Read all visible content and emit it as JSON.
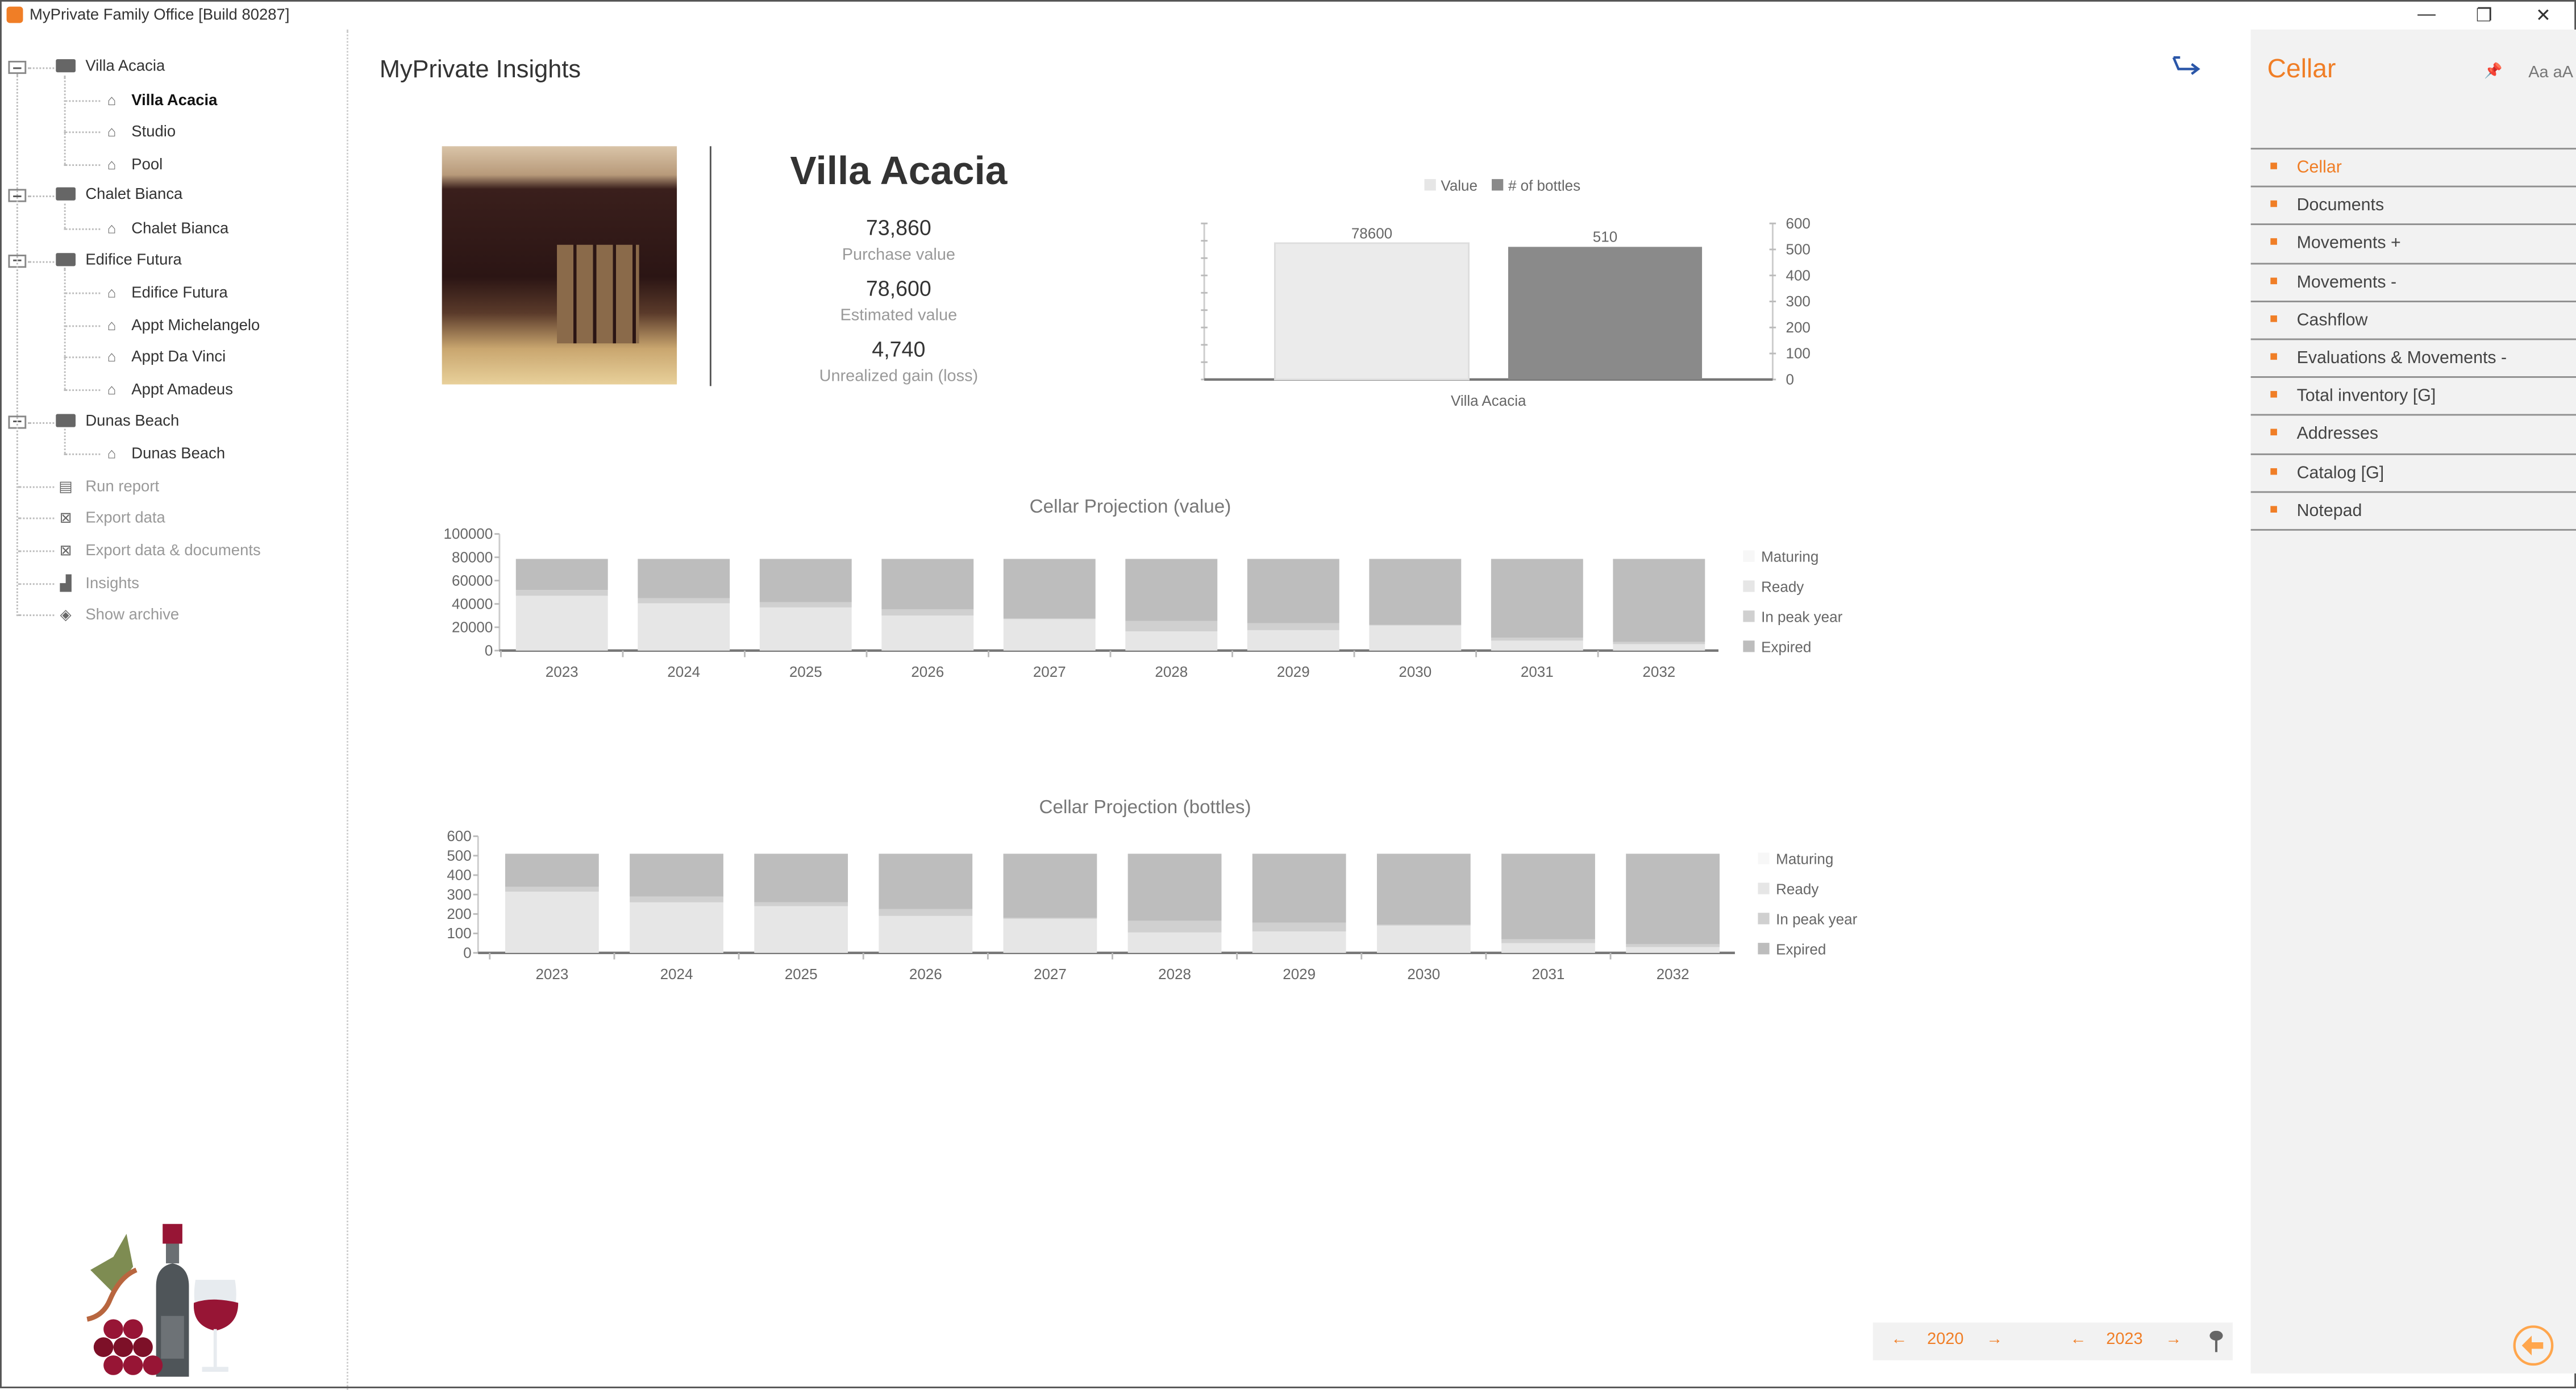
{
  "window": {
    "title": "MyPrivate Family Office [Build 80287]",
    "minimize": "—",
    "restore": "❐",
    "close": "✕"
  },
  "tree": {
    "groups": [
      {
        "label": "Villa Acacia",
        "children": [
          "Villa Acacia",
          "Studio",
          "Pool"
        ]
      },
      {
        "label": "Chalet Bianca",
        "children": [
          "Chalet Bianca"
        ]
      },
      {
        "label": "Edifice Futura",
        "children": [
          "Edifice Futura",
          "Appt Michelangelo",
          "Appt Da Vinci",
          "Appt Amadeus"
        ]
      },
      {
        "label": "Dunas Beach",
        "children": [
          "Dunas Beach"
        ]
      }
    ],
    "selected": "Villa Acacia",
    "actions": [
      {
        "label": "Run report",
        "icon": "report-icon"
      },
      {
        "label": "Export data",
        "icon": "excel-icon"
      },
      {
        "label": "Export data & documents",
        "icon": "excel-icon"
      },
      {
        "label": "Insights",
        "icon": "bar-chart-icon"
      },
      {
        "label": "Show archive",
        "icon": "archive-icon"
      }
    ]
  },
  "main": {
    "title": "MyPrivate Insights",
    "property": {
      "name": "Villa Acacia",
      "stats": [
        {
          "value": "73,860",
          "label": "Purchase value"
        },
        {
          "value": "78,600",
          "label": "Estimated value"
        },
        {
          "value": "4,740",
          "label": "Unrealized gain (loss)"
        }
      ]
    }
  },
  "colors": {
    "accent": "#f07e26",
    "maturing": "#f7f7f7",
    "ready": "#e6e6e6",
    "peak": "#d0d0d0",
    "expired": "#bdbdbd",
    "value_bar": "#ebebeb",
    "bottles_bar": "#8a8a8a"
  },
  "chart_data": [
    {
      "type": "bar",
      "title": "",
      "categories": [
        "Villa Acacia"
      ],
      "series": [
        {
          "name": "Value",
          "values": [
            78600
          ],
          "axis": "left",
          "label": "78600"
        },
        {
          "name": "# of bottles",
          "values": [
            510
          ],
          "axis": "right",
          "label": "510"
        }
      ],
      "ylim_left": [
        0,
        90000
      ],
      "ylim_right": [
        0,
        600
      ],
      "right_ticks": [
        "0",
        "100",
        "200",
        "300",
        "400",
        "500",
        "600"
      ],
      "legend": "top"
    },
    {
      "type": "bar",
      "stacked": true,
      "title": "Cellar Projection (value)",
      "categories": [
        "2023",
        "2024",
        "2025",
        "2026",
        "2027",
        "2028",
        "2029",
        "2030",
        "2031",
        "2032"
      ],
      "series": [
        {
          "name": "Maturing",
          "values": [
            0,
            0,
            0,
            0,
            0,
            0,
            0,
            0,
            0,
            0
          ]
        },
        {
          "name": "Ready",
          "values": [
            47000,
            40500,
            37000,
            30000,
            27000,
            16500,
            17500,
            21500,
            8500,
            5500
          ]
        },
        {
          "name": "In peak year",
          "values": [
            5000,
            4500,
            4500,
            5500,
            500,
            9000,
            6000,
            500,
            2500,
            2000
          ]
        },
        {
          "name": "Expired",
          "values": [
            26600,
            33600,
            37100,
            43100,
            51100,
            53100,
            55100,
            56600,
            67600,
            71100
          ]
        }
      ],
      "ylim": [
        0,
        100000
      ],
      "ticks": [
        "0",
        "20000",
        "40000",
        "60000",
        "80000",
        "100000"
      ],
      "legend": "right"
    },
    {
      "type": "bar",
      "stacked": true,
      "title": "Cellar Projection (bottles)",
      "categories": [
        "2023",
        "2024",
        "2025",
        "2026",
        "2027",
        "2028",
        "2029",
        "2030",
        "2031",
        "2032"
      ],
      "series": [
        {
          "name": "Maturing",
          "values": [
            0,
            0,
            0,
            0,
            0,
            0,
            0,
            0,
            0,
            0
          ]
        },
        {
          "name": "Ready",
          "values": [
            315,
            260,
            240,
            190,
            175,
            105,
            110,
            140,
            50,
            30
          ]
        },
        {
          "name": "In peak year",
          "values": [
            25,
            30,
            20,
            35,
            5,
            60,
            45,
            5,
            20,
            15
          ]
        },
        {
          "name": "Expired",
          "values": [
            170,
            220,
            250,
            285,
            330,
            345,
            355,
            365,
            440,
            465
          ]
        }
      ],
      "ylim": [
        0,
        600
      ],
      "ticks": [
        "0",
        "100",
        "200",
        "300",
        "400",
        "500",
        "600"
      ],
      "legend": "right"
    }
  ],
  "panel": {
    "title": "Cellar",
    "font_toggle": "Aa aA",
    "active": "Cellar",
    "items": [
      "Cellar",
      "Documents",
      "Movements +",
      "Movements -",
      "Cashflow",
      "Evaluations & Movements -",
      "Total inventory [G]",
      "Addresses",
      "Catalog [G]",
      "Notepad"
    ]
  },
  "footer": {
    "year_from": "2020",
    "year_to": "2023",
    "prev": "←",
    "next": "→"
  }
}
